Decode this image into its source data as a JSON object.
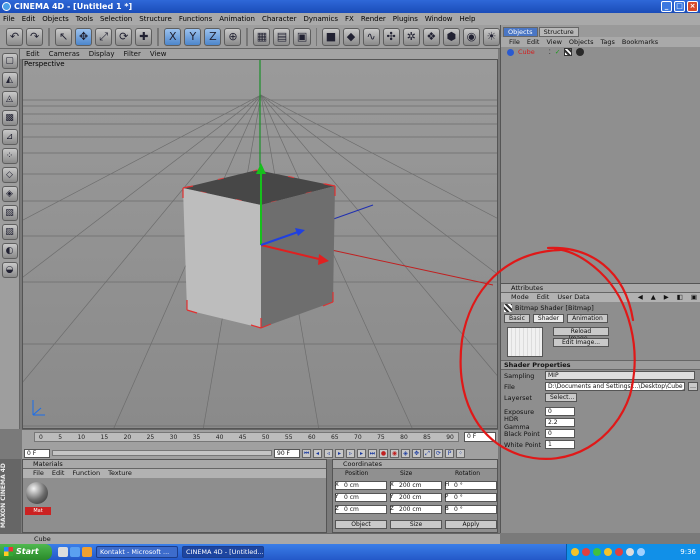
{
  "window": {
    "title": "CINEMA 4D - [Untitled 1 *]"
  },
  "menubar": [
    "File",
    "Edit",
    "Objects",
    "Tools",
    "Selection",
    "Structure",
    "Functions",
    "Animation",
    "Character",
    "Dynamics",
    "FX",
    "Render",
    "Plugins",
    "Window",
    "Help"
  ],
  "viewport": {
    "menu": [
      "Edit",
      "Cameras",
      "Display",
      "Filter",
      "View"
    ],
    "label": "Perspective"
  },
  "timeline": {
    "ticks": [
      "0",
      "5",
      "10",
      "15",
      "20",
      "25",
      "30",
      "35",
      "40",
      "45",
      "50",
      "55",
      "60",
      "65",
      "70",
      "75",
      "80",
      "85",
      "90"
    ],
    "current_frame": "0 F"
  },
  "playbar": {
    "start": "0 F",
    "end": "90 F"
  },
  "materials": {
    "title": "Materials",
    "menu": [
      "File",
      "Edit",
      "Function",
      "Texture"
    ],
    "material_name": "Mat"
  },
  "coordinates": {
    "title": "Coordinates",
    "headers": [
      "Position",
      "Size",
      "Rotation"
    ],
    "rows": [
      [
        "0 cm",
        "200 cm",
        "0 °"
      ],
      [
        "0 cm",
        "200 cm",
        "0 °"
      ],
      [
        "0 cm",
        "200 cm",
        "0 °"
      ]
    ],
    "axis_labels_pos": [
      "X",
      "Y",
      "Z"
    ],
    "axis_labels_size": [
      "X",
      "Y",
      "Z"
    ],
    "axis_labels_rot": [
      "H",
      "P",
      "B"
    ],
    "mode_options": [
      "Object",
      "Size",
      "Apply"
    ]
  },
  "status": {
    "text": "Cube"
  },
  "maxon": {
    "text": "MAXON CINEMA 4D"
  },
  "objects": {
    "tabs": [
      "Objects",
      "Structure"
    ],
    "menu": [
      "File",
      "Edit",
      "View",
      "Objects",
      "Tags",
      "Bookmarks"
    ],
    "item": "Cube"
  },
  "attributes": {
    "title": "Attributes",
    "menu": [
      "Mode",
      "Edit",
      "User Data"
    ],
    "shader_title": "Bitmap Shader [Bitmap]",
    "tabs": [
      "Basic",
      "Shader",
      "Animation"
    ],
    "buttons": [
      "Reload Image...",
      "Edit Image..."
    ],
    "section": "Shader Properties",
    "fields": [
      {
        "label": "Sampling",
        "value": "MIP"
      },
      {
        "label": "File",
        "value": "D:\\Documents and Settings\\...\\Desktop\\Cube_uvMap.bm"
      },
      {
        "label": "Layerset",
        "value": "Select..."
      },
      {
        "label": "Exposure",
        "value": "0"
      },
      {
        "label": "HDR Gamma",
        "value": "2.2"
      },
      {
        "label": "Black Point",
        "value": "0"
      },
      {
        "label": "White Point",
        "value": "1"
      }
    ]
  },
  "taskbar": {
    "start": "Start",
    "tasks": [
      "Kontakt - Microsoft ...",
      "CINEMA 4D - [Untitled..."
    ],
    "clock": "9:36"
  },
  "colors": {
    "title_bar": "#2f68d8",
    "accent": "#4a76c4",
    "red_annotation": "#e01818"
  }
}
